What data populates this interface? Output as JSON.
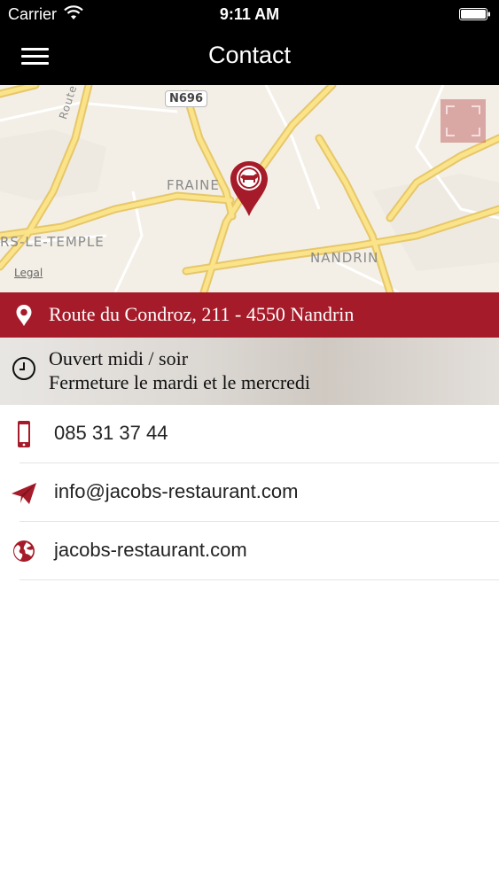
{
  "status_bar": {
    "carrier": "Carrier",
    "time": "9:11 AM"
  },
  "nav": {
    "title": "Contact",
    "menu_icon": "hamburger-menu-icon"
  },
  "map": {
    "road_sign": "N696",
    "labels": {
      "fraine": "FRAINE",
      "temple": "RS-LE-TEMPLE",
      "nandrin": "NANDRIN",
      "route": "Route-de-Vi"
    },
    "legal": "Legal",
    "expand_icon": "fullscreen-icon",
    "pin_icon": "restaurant-map-pin-icon"
  },
  "address": {
    "icon": "location-pin-icon",
    "text": "Route du Condroz, 211 - 4550 Nandrin"
  },
  "hours": {
    "icon": "clock-icon",
    "line1": "Ouvert midi / soir",
    "line2": "Fermeture le mardi et le mercredi"
  },
  "contacts": {
    "phone": {
      "icon": "phone-icon",
      "text": "085 31 37 44"
    },
    "email": {
      "icon": "paper-plane-icon",
      "text": "info@jacobs-restaurant.com"
    },
    "website": {
      "icon": "globe-icon",
      "text": "jacobs-restaurant.com"
    }
  },
  "colors": {
    "brand": "#a61b29",
    "bar_background": "#000000"
  }
}
